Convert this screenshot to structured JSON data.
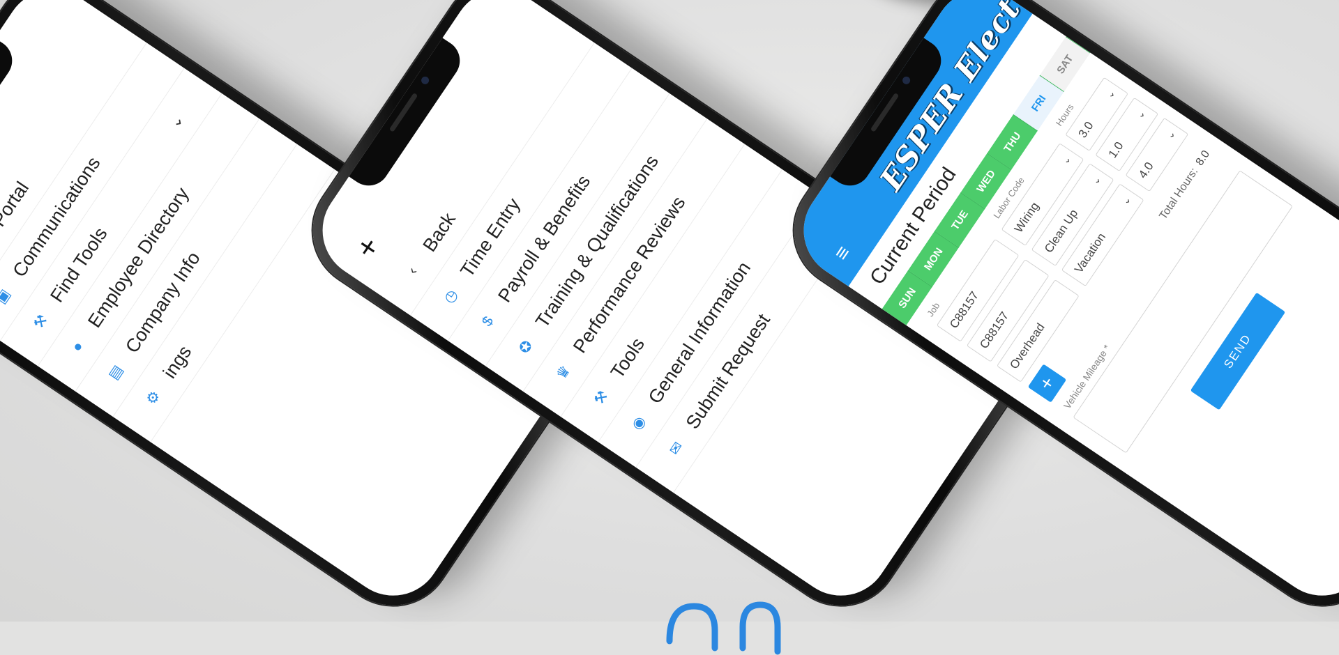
{
  "phone1": {
    "close_icon": "+",
    "menu": [
      {
        "icon": "portal-icon",
        "glyph": "◉",
        "label": "My Portal"
      },
      {
        "icon": "calendar-icon",
        "glyph": "▣",
        "label": "Communications"
      },
      {
        "icon": "wrench-icon",
        "glyph": "⚒",
        "label": "Find Tools"
      },
      {
        "icon": "person-icon",
        "glyph": "●",
        "label": "Employee Directory"
      },
      {
        "icon": "id-card-icon",
        "glyph": "▤",
        "label": "Company Info"
      },
      {
        "icon": "settings-icon",
        "glyph": "⚙",
        "label": "ings"
      }
    ],
    "chevron": "⌄"
  },
  "phone2": {
    "close_icon": "+",
    "back_label": "Back",
    "back_glyph": "‹",
    "menu": [
      {
        "icon": "stopwatch-icon",
        "glyph": "◷",
        "label": "Time Entry"
      },
      {
        "icon": "dollar-icon",
        "glyph": "$",
        "label": "Payroll & Benefits"
      },
      {
        "icon": "certificate-icon",
        "glyph": "✪",
        "label": "Training & Qualifications"
      },
      {
        "icon": "trophy-icon",
        "glyph": "♛",
        "label": "Performance Reviews"
      },
      {
        "icon": "wrench-icon",
        "glyph": "⚒",
        "label": "Tools"
      },
      {
        "icon": "info-icon",
        "glyph": "◉",
        "label": "General Information"
      },
      {
        "icon": "submit-icon",
        "glyph": "✉",
        "label": "Submit Request"
      }
    ]
  },
  "phone3": {
    "brand": "ESPER Electric",
    "menu_icon": "≡",
    "title": "Current Period",
    "days": [
      "SUN",
      "MON",
      "TUE",
      "WED",
      "THU",
      "FRI",
      "SAT"
    ],
    "active_day": "FRI",
    "labels": {
      "job": "Job",
      "labor_code": "Labor Code",
      "hours": "Hours"
    },
    "rows": [
      {
        "job": "C88157",
        "labor": "Wiring",
        "hours": "3.0"
      },
      {
        "job": "C88157",
        "labor": "Clean Up",
        "hours": "1.0"
      },
      {
        "job": "Overhead",
        "labor": "Vacation",
        "hours": "4.0"
      }
    ],
    "add_label": "+",
    "mileage_label": "Vehicle Mileage *",
    "total_label": "Total Hours:",
    "total_value": "8.0",
    "send_label": "SEND",
    "caret": "⌄"
  }
}
